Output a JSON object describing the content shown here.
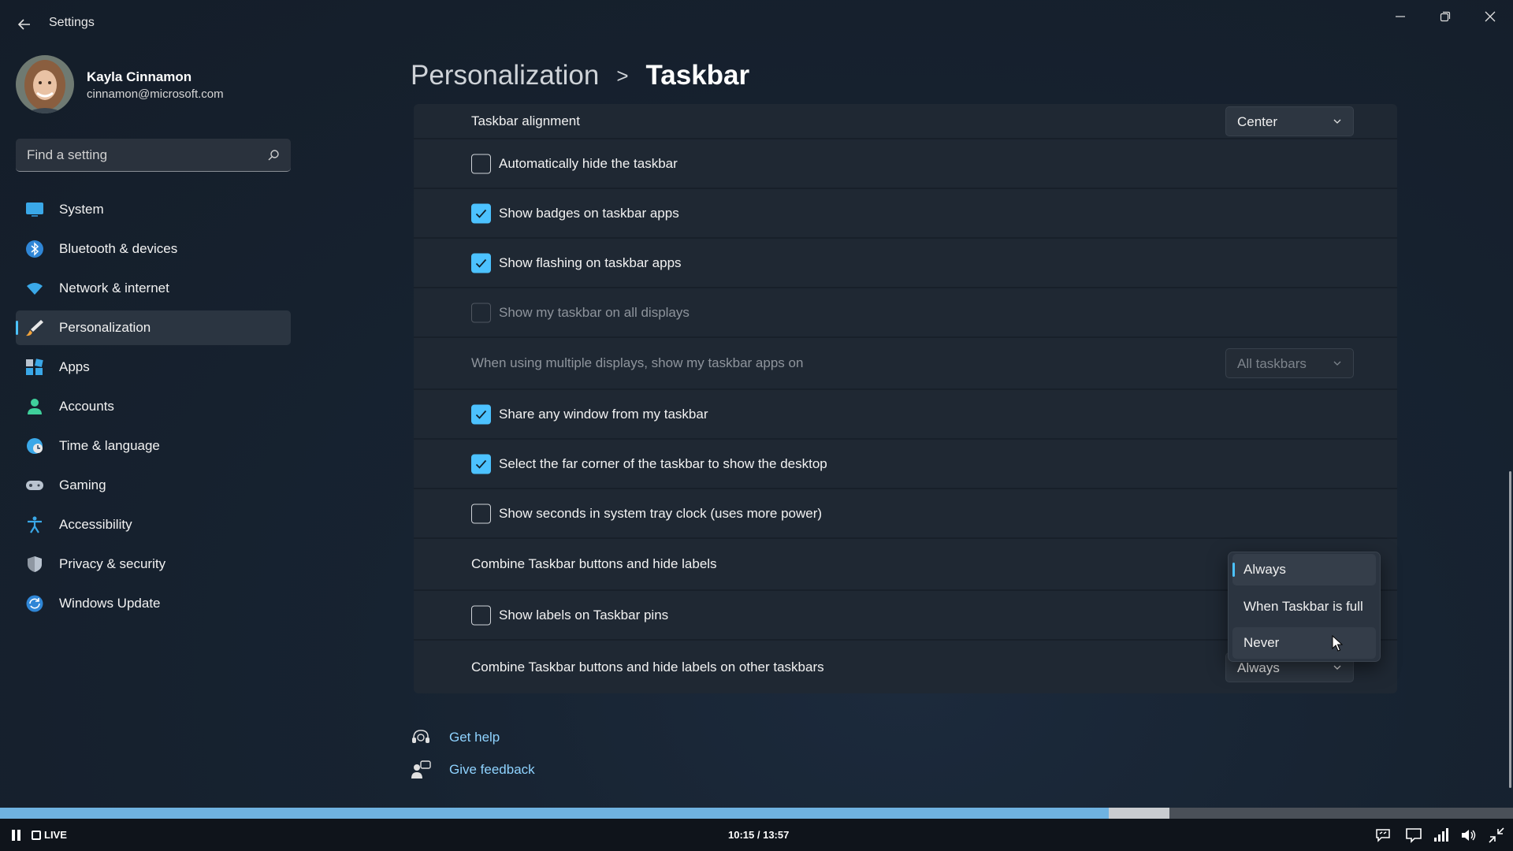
{
  "window": {
    "title": "Settings",
    "controls": [
      "minimize",
      "restore",
      "close"
    ]
  },
  "profile": {
    "name": "Kayla Cinnamon",
    "email": "cinnamon@microsoft.com"
  },
  "search": {
    "placeholder": "Find a setting"
  },
  "sidebar": {
    "items": [
      {
        "label": "System",
        "icon": "monitor-icon",
        "active": false
      },
      {
        "label": "Bluetooth & devices",
        "icon": "bluetooth-icon",
        "active": false
      },
      {
        "label": "Network & internet",
        "icon": "wifi-icon",
        "active": false
      },
      {
        "label": "Personalization",
        "icon": "brush-icon",
        "active": true
      },
      {
        "label": "Apps",
        "icon": "apps-icon",
        "active": false
      },
      {
        "label": "Accounts",
        "icon": "person-icon",
        "active": false
      },
      {
        "label": "Time & language",
        "icon": "globe-clock-icon",
        "active": false
      },
      {
        "label": "Gaming",
        "icon": "gamepad-icon",
        "active": false
      },
      {
        "label": "Accessibility",
        "icon": "accessibility-icon",
        "active": false
      },
      {
        "label": "Privacy & security",
        "icon": "shield-icon",
        "active": false
      },
      {
        "label": "Windows Update",
        "icon": "update-icon",
        "active": false
      }
    ]
  },
  "breadcrumb": {
    "parent": "Personalization",
    "separator": ">",
    "current": "Taskbar"
  },
  "settings": {
    "alignment": {
      "label": "Taskbar alignment",
      "value": "Center"
    },
    "auto_hide": {
      "label": "Automatically hide the taskbar",
      "checked": false
    },
    "badges": {
      "label": "Show badges on taskbar apps",
      "checked": true
    },
    "flashing": {
      "label": "Show flashing on taskbar apps",
      "checked": true
    },
    "all_displays": {
      "label": "Show my taskbar on all displays",
      "checked": false,
      "disabled": true
    },
    "multi_display": {
      "label": "When using multiple displays, show my taskbar apps on",
      "value": "All taskbars",
      "disabled": true
    },
    "share_window": {
      "label": "Share any window from my taskbar",
      "checked": true
    },
    "far_corner": {
      "label": "Select the far corner of the taskbar to show the desktop",
      "checked": true
    },
    "seconds": {
      "label": "Show seconds in system tray clock (uses more power)",
      "checked": false
    },
    "combine": {
      "label": "Combine Taskbar buttons and hide labels"
    },
    "labels_pins": {
      "label": "Show labels on Taskbar pins",
      "checked": false
    },
    "combine_other": {
      "label": "Combine Taskbar buttons and hide labels on other taskbars",
      "value": "Always"
    }
  },
  "combine_popup": {
    "options": [
      "Always",
      "When Taskbar is full",
      "Never"
    ],
    "selected": "Always",
    "hovered": "Never"
  },
  "help": {
    "get_help": "Get help",
    "give_feedback": "Give feedback"
  },
  "player": {
    "live_label": "LIVE",
    "time": "10:15 / 13:57",
    "progress": 0.733,
    "buffered": 0.773
  },
  "colors": {
    "accent": "#4cc2ff",
    "background": "#172331",
    "card": "#1f2833"
  }
}
